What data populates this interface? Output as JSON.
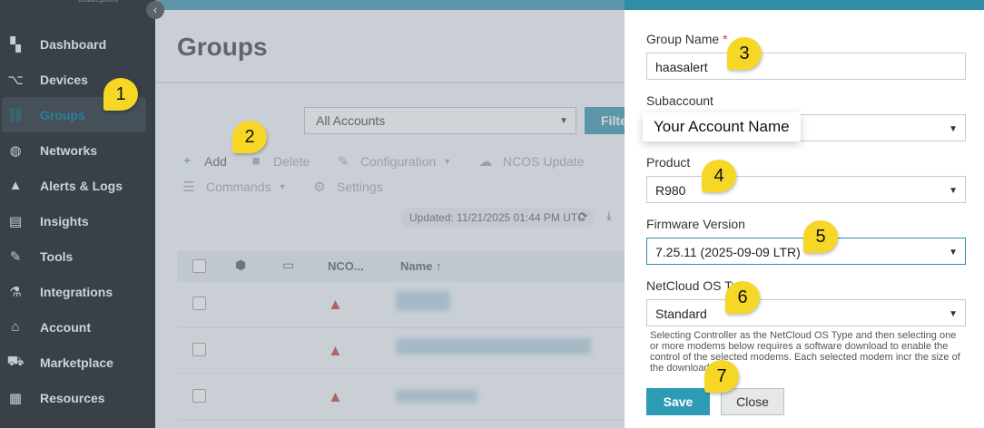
{
  "sidebar": {
    "brand": "cradlepoint",
    "collapse_glyph": "‹",
    "items": [
      {
        "label": "Dashboard",
        "icon": "dashboard-icon"
      },
      {
        "label": "Devices",
        "icon": "router-icon"
      },
      {
        "label": "Groups",
        "icon": "groups-icon",
        "active": true
      },
      {
        "label": "Networks",
        "icon": "globe-icon"
      },
      {
        "label": "Alerts & Logs",
        "icon": "warning-icon"
      },
      {
        "label": "Insights",
        "icon": "document-icon"
      },
      {
        "label": "Tools",
        "icon": "wrench-icon"
      },
      {
        "label": "Integrations",
        "icon": "flask-icon"
      },
      {
        "label": "Account",
        "icon": "bank-icon"
      },
      {
        "label": "Marketplace",
        "icon": "cart-icon"
      },
      {
        "label": "Resources",
        "icon": "clipboard-icon"
      }
    ]
  },
  "main": {
    "title": "Groups",
    "account_filter": "All Accounts",
    "filter_button": "Filte",
    "toolbar": {
      "add": "Add",
      "delete": "Delete",
      "configuration": "Configuration",
      "ncos_update": "NCOS Update",
      "commands": "Commands",
      "settings": "Settings"
    },
    "updated": "Updated: 11/21/2025 01:44 PM UTC",
    "table": {
      "columns": [
        "NCO...",
        "Name ↑"
      ]
    }
  },
  "modal": {
    "group_name_label": "Group Name",
    "required_mark": "*",
    "group_name_value": "haasalert",
    "subaccount_label": "Subaccount",
    "subaccount_value": "Your Account Name",
    "product_label": "Product",
    "product_value": "R980",
    "firmware_label": "Firmware Version",
    "firmware_value": "7.25.11 (2025-09-09 LTR)",
    "os_type_label": "NetCloud OS Ty",
    "os_type_value": "Standard",
    "help_text": "Selecting Controller as the NetCloud OS Type and then selecting one or more modems below requires a software download to enable the control of the selected modems. Each selected modem incr the size of the download.",
    "save": "Save",
    "close": "Close"
  },
  "steps": [
    "1",
    "2",
    "3",
    "4",
    "5",
    "6",
    "7"
  ],
  "colors": {
    "accent": "#2e8ea6",
    "sidebar_bg": "#3a4048",
    "callout": "#f6d726",
    "warning": "#c0392b"
  }
}
